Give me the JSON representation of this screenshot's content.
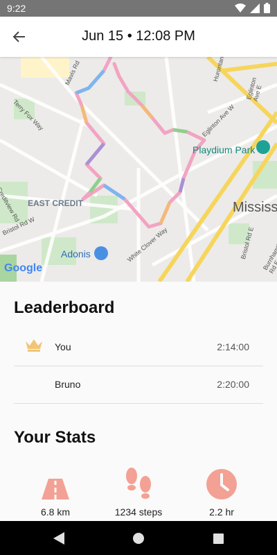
{
  "status_bar": {
    "time": "9:22"
  },
  "header": {
    "title": "Jun 15 • 12:08 PM"
  },
  "map": {
    "labels": {
      "playdium_park": "Playdium Park",
      "east_credit": "EAST CREDIT",
      "adonis": "Adonis",
      "mississauga": "Mississ",
      "google": "Google",
      "terry_fox_way": "Terry Fox Way",
      "mavis_rd": "Mavis Rd",
      "creditview_rd": "Creditview Rd",
      "bristol_rd_w": "Bristol Rd W",
      "white_clover_way": "White Clover Way",
      "eglinton_ave_w": "Eglinton Ave W",
      "hurontario_st": "Hurontario St",
      "eglinton_ave_e": "Eglinton Ave E",
      "bristol_rd_e": "Bristol Rd E",
      "burnhamthorpe_rd_e": "Burnhamthorpe Rd E"
    }
  },
  "leaderboard": {
    "title": "Leaderboard",
    "rows": [
      {
        "name": "You",
        "time": "2:14:00"
      },
      {
        "name": "Bruno",
        "time": "2:20:00"
      }
    ]
  },
  "stats": {
    "title": "Your Stats",
    "distance": "6.8 km",
    "steps": "1234 steps",
    "duration": "2.2 hr"
  },
  "colors": {
    "accent": "#f3a194",
    "crown": "#f2c477",
    "road_major": "#f6d55c"
  }
}
